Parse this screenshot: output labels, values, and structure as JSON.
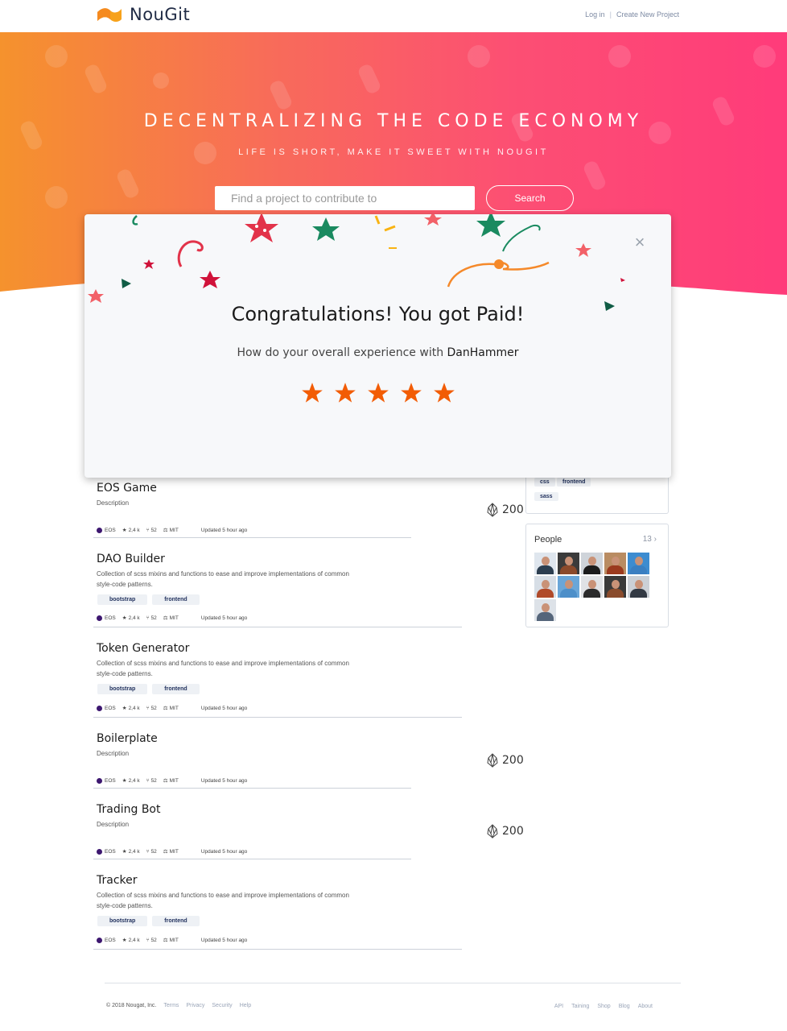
{
  "header": {
    "brand": "NouGit",
    "login": "Log in",
    "separator": "|",
    "create": "Create New Project"
  },
  "hero": {
    "title": "DECENTRALIZING THE CODE ECONOMY",
    "subtitle": "LIFE IS SHORT, MAKE IT SWEET WITH NOUGIT",
    "search_placeholder": "Find a project to contribute to",
    "search_button": "Search"
  },
  "modal": {
    "close": "×",
    "title": "Congratulations! You got Paid!",
    "question": "How do your overall experience with",
    "user": "DanHammer",
    "rating": 5,
    "rating_max": 5,
    "star_color": "#f25c05"
  },
  "projects": [
    {
      "title": "EOS Game",
      "desc": "Description",
      "tags": [],
      "lang": "EOS",
      "stars": "2,4 k",
      "forks": "52",
      "license": "MIT",
      "updated": "Updated 5 hour ago",
      "reward": "200"
    },
    {
      "title": "DAO Builder",
      "desc": "Collection of scss mixins and functions to ease and improve implementations of common style-code patterns.",
      "tags": [
        "bootstrap",
        "frontend"
      ],
      "lang": "EOS",
      "stars": "2,4 k",
      "forks": "52",
      "license": "MIT",
      "updated": "Updated 5 hour ago"
    },
    {
      "title": "Token Generator",
      "desc": "Collection of scss mixins and functions to ease and improve implementations of common style-code patterns.",
      "tags": [
        "bootstrap",
        "frontend"
      ],
      "lang": "EOS",
      "stars": "2,4 k",
      "forks": "52",
      "license": "MIT",
      "updated": "Updated 5 hour ago"
    },
    {
      "title": "Boilerplate",
      "desc": "Description",
      "tags": [],
      "lang": "EOS",
      "stars": "2,4 k",
      "forks": "52",
      "license": "MIT",
      "updated": "Updated 5 hour ago",
      "reward": "200"
    },
    {
      "title": "Trading Bot",
      "desc": "Description",
      "tags": [],
      "lang": "EOS",
      "stars": "2,4 k",
      "forks": "52",
      "license": "MIT",
      "updated": "Updated 5 hour ago",
      "reward": "200"
    },
    {
      "title": "Tracker",
      "desc": "Collection of scss mixins and functions to ease and improve implementations of common style-code patterns.",
      "tags": [
        "bootstrap",
        "frontend"
      ],
      "lang": "EOS",
      "stars": "2,4 k",
      "forks": "52",
      "license": "MIT",
      "updated": "Updated 5 hour ago"
    }
  ],
  "sidebar": {
    "topics": [
      "css",
      "frontend",
      "sass"
    ],
    "people_title": "People",
    "people_count": "13",
    "avatar_colors": [
      "#2c3e50",
      "#8b4a2b",
      "#1c1c1c",
      "#9b3a1e",
      "#3a7fc1",
      "#b04a2a",
      "#4d8fc9",
      "#2b2b2b",
      "#8a4b2c",
      "#333a44",
      "#55657a"
    ]
  },
  "footer": {
    "copyright": "© 2018 Nougat, Inc.",
    "left_links": [
      "Terms",
      "Privacy",
      "Security",
      "Help"
    ],
    "right_links": [
      "API",
      "Taining",
      "Shop",
      "Blog",
      "About"
    ]
  },
  "colors": {
    "hero_start": "#f5922d",
    "hero_end": "#ff3b7a",
    "lang_dot": "#3d1770",
    "tag_text": "#1f2f5c"
  }
}
